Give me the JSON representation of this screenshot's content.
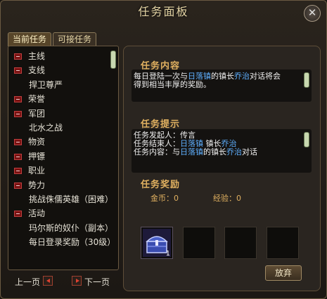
{
  "panel": {
    "title": "任务面板",
    "close_label": "✕"
  },
  "tabs": [
    {
      "label": "当前任务",
      "active": true
    },
    {
      "label": "可接任务",
      "active": false
    }
  ],
  "quest_list": [
    {
      "label": "主线",
      "type": "category"
    },
    {
      "label": "支线",
      "type": "category"
    },
    {
      "label": "捍卫尊严",
      "type": "quest"
    },
    {
      "label": "荣誉",
      "type": "category"
    },
    {
      "label": "军团",
      "type": "category"
    },
    {
      "label": "北水之战",
      "type": "quest"
    },
    {
      "label": "物资",
      "type": "category"
    },
    {
      "label": "押镖",
      "type": "category"
    },
    {
      "label": "职业",
      "type": "category"
    },
    {
      "label": "势力",
      "type": "category"
    },
    {
      "label": "挑战侏儒英雄（困难）",
      "type": "quest"
    },
    {
      "label": "活动",
      "type": "category"
    },
    {
      "label": "玛尔斯的奴仆（副本）",
      "type": "quest"
    },
    {
      "label": "每日登录奖励（30级）",
      "type": "quest"
    }
  ],
  "pager": {
    "prev_label": "上一页",
    "next_label": "下一页"
  },
  "details": {
    "content_title": "任务内容",
    "content_line1_a": "每日登陆一次与",
    "content_line1_town": "日落镇",
    "content_line1_b": "的镇长",
    "content_line1_npc": "乔治",
    "content_line1_c": "对话将会",
    "content_line2": "得到相当丰厚的奖励。",
    "hint_title": "任务提示",
    "hint_giver_label": "任务发起人：",
    "hint_giver": "传言",
    "hint_end_label": "任务结束人：",
    "hint_end_town": "日落镇",
    "hint_end_mid": " 镇长",
    "hint_end_npc": "乔治",
    "hint_content_label": "任务内容：与",
    "hint_content_town": "日落镇",
    "hint_content_mid": "的镇长",
    "hint_content_npc": "乔治",
    "hint_content_end": "对话",
    "reward_title": "任务奖励",
    "gold_label": "金币：",
    "gold_value": "0",
    "exp_label": "经验：",
    "exp_value": "0",
    "item_count": "1",
    "abandon_label": "放弃"
  },
  "colors": {
    "highlight": "#5fb0ff",
    "section": "#e0b060",
    "accent_red": "#7a1212"
  }
}
